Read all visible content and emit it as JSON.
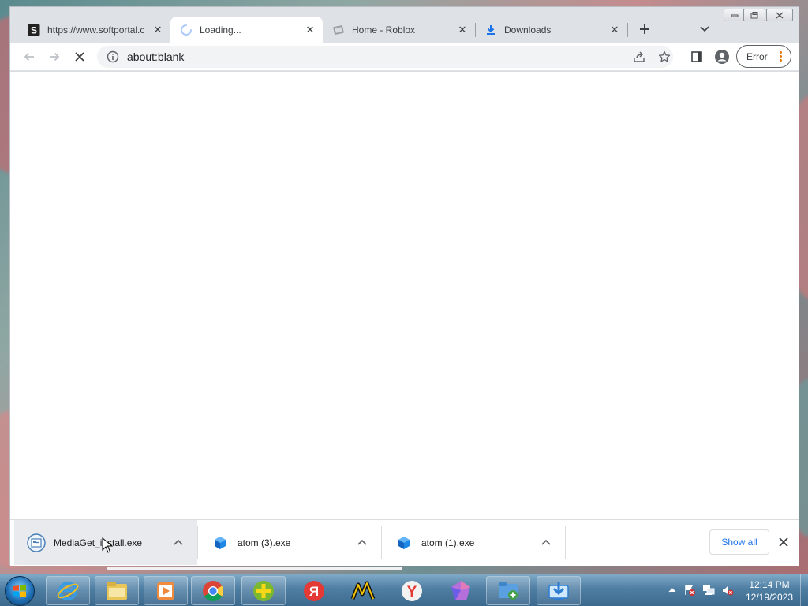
{
  "browser": {
    "tabs": [
      {
        "title": "https://www.softportal.c",
        "favicon": "softportal-icon",
        "active": false
      },
      {
        "title": "Loading...",
        "favicon": "loading-spinner-icon",
        "active": true
      },
      {
        "title": "Home - Roblox",
        "favicon": "roblox-icon",
        "active": false
      },
      {
        "title": "Downloads",
        "favicon": "download-icon",
        "active": false
      }
    ],
    "address": {
      "url": "about:blank"
    },
    "profile_status": "Error"
  },
  "downloads_shelf": {
    "items": [
      {
        "filename": "MediaGet_install.exe",
        "icon": "mediaget-icon"
      },
      {
        "filename": "atom (3).exe",
        "icon": "atom-package-icon"
      },
      {
        "filename": "atom (1).exe",
        "icon": "atom-package-icon"
      }
    ],
    "show_all_label": "Show all"
  },
  "taskbar": {
    "apps": [
      "internet-explorer-icon",
      "windows-explorer-icon",
      "media-player-icon",
      "chrome-icon",
      "plus-app-icon",
      "yandex-browser-icon",
      "music-app-icon",
      "yandex-icon",
      "gem-app-icon",
      "folder-add-icon",
      "download-manager-icon"
    ],
    "clock": {
      "time": "12:14 PM",
      "date": "12/19/2023"
    }
  },
  "colors": {
    "accent_blue": "#1a73e8",
    "error_orange": "#e37400",
    "tab_strip": "#dee1e6"
  }
}
